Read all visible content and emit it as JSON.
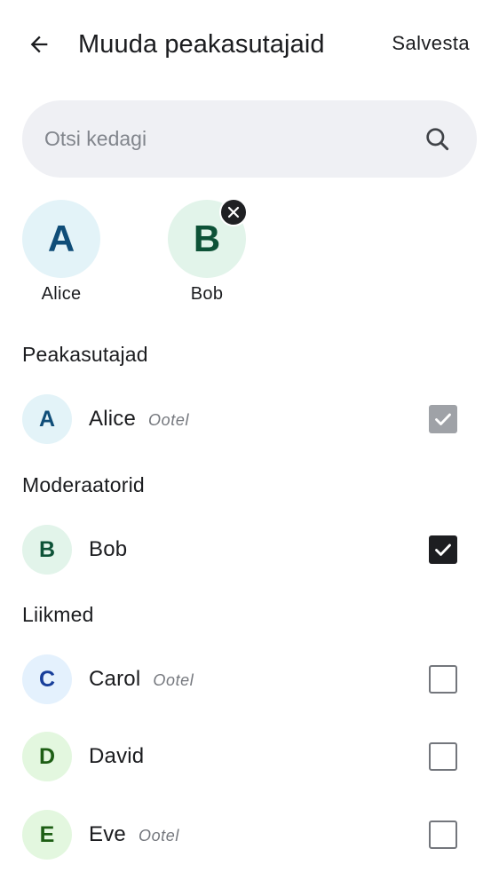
{
  "header": {
    "title": "Muuda peakasutajaid",
    "save_label": "Salvesta",
    "back_icon": "arrow-left-icon"
  },
  "search": {
    "placeholder": "Otsi kedagi",
    "value": "",
    "icon": "search-icon"
  },
  "selected": [
    {
      "initial": "A",
      "name": "Alice",
      "removable": false
    },
    {
      "initial": "B",
      "name": "Bob",
      "removable": true
    }
  ],
  "sections": [
    {
      "title": "Peakasutajad",
      "members": [
        {
          "initial": "A",
          "name": "Alice",
          "status": "Ootel",
          "checked": true,
          "disabled": true
        }
      ]
    },
    {
      "title": "Moderaatorid",
      "members": [
        {
          "initial": "B",
          "name": "Bob",
          "status": "",
          "checked": true,
          "disabled": false
        }
      ]
    },
    {
      "title": "Liikmed",
      "members": [
        {
          "initial": "C",
          "name": "Carol",
          "status": "Ootel",
          "checked": false,
          "disabled": false
        },
        {
          "initial": "D",
          "name": "David",
          "status": "",
          "checked": false,
          "disabled": false
        },
        {
          "initial": "E",
          "name": "Eve",
          "status": "Ootel",
          "checked": false,
          "disabled": false
        }
      ]
    }
  ],
  "colors": {
    "search_bg": "#eff0f4",
    "checkbox_checked": "#1d1e21",
    "checkbox_disabled": "#9fa2a7"
  }
}
